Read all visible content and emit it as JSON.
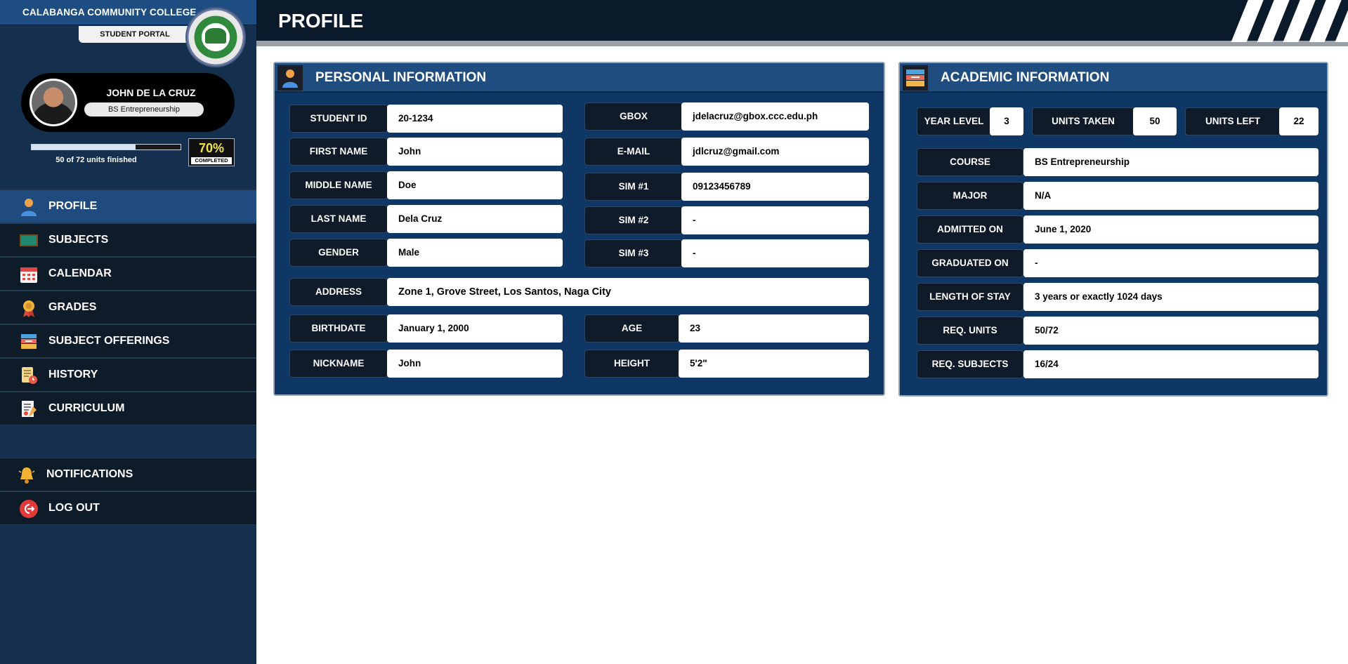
{
  "sidebar": {
    "college_name": "CALABANGA COMMUNITY COLLEGE",
    "portal_label": "STUDENT PORTAL",
    "student_name": "JOHN DE LA CRUZ",
    "course": "BS Entrepreneurship",
    "progress": {
      "fraction": 0.7,
      "text": "50 of 72 units finished",
      "percent_label": "70%",
      "completed_label": "COMPLETED"
    },
    "nav": [
      {
        "label": "PROFILE",
        "icon": "person-icon",
        "active": true
      },
      {
        "label": "SUBJECTS",
        "icon": "chalkboard-icon"
      },
      {
        "label": "CALENDAR",
        "icon": "calendar-icon"
      },
      {
        "label": "GRADES",
        "icon": "medal-icon"
      },
      {
        "label": "SUBJECT OFFERINGS",
        "icon": "books-icon"
      },
      {
        "label": "HISTORY",
        "icon": "scroll-clock-icon"
      },
      {
        "label": "CURRICULUM",
        "icon": "document-pen-icon"
      },
      {
        "label": "NOTIFICATIONS",
        "icon": "bell-icon"
      },
      {
        "label": "LOG OUT",
        "icon": "logout-icon"
      }
    ]
  },
  "header": {
    "title": "PROFILE"
  },
  "personal": {
    "title": "PERSONAL INFORMATION",
    "student_id": {
      "label": "STUDENT ID",
      "value": "20-1234"
    },
    "first_name": {
      "label": "FIRST NAME",
      "value": "John"
    },
    "middle_name": {
      "label": "MIDDLE NAME",
      "value": "Doe"
    },
    "last_name": {
      "label": "LAST NAME",
      "value": "Dela Cruz"
    },
    "gender": {
      "label": "GENDER",
      "value": "Male"
    },
    "gbox": {
      "label": "GBOX",
      "value": "jdelacruz@gbox.ccc.edu.ph"
    },
    "email": {
      "label": "E-MAIL",
      "value": "jdlcruz@gmail.com"
    },
    "sim1": {
      "label": "SIM #1",
      "value": "09123456789"
    },
    "sim2": {
      "label": "SIM #2",
      "value": "-"
    },
    "sim3": {
      "label": "SIM #3",
      "value": "-"
    },
    "address": {
      "label": "ADDRESS",
      "value": "Zone 1, Grove Street, Los Santos, Naga City"
    },
    "birthdate": {
      "label": "BIRTHDATE",
      "value": "January 1, 2000"
    },
    "nickname": {
      "label": "NICKNAME",
      "value": "John"
    },
    "age": {
      "label": "AGE",
      "value": "23"
    },
    "height": {
      "label": "HEIGHT",
      "value": "5'2\""
    }
  },
  "academic": {
    "title": "ACADEMIC INFORMATION",
    "year_level": {
      "label": "YEAR LEVEL",
      "value": "3"
    },
    "units_taken": {
      "label": "UNITS TAKEN",
      "value": "50"
    },
    "units_left": {
      "label": "UNITS LEFT",
      "value": "22"
    },
    "course": {
      "label": "COURSE",
      "value": "BS Entrepreneurship"
    },
    "major": {
      "label": "MAJOR",
      "value": "N/A"
    },
    "admitted_on": {
      "label": "ADMITTED ON",
      "value": "June 1, 2020"
    },
    "graduated_on": {
      "label": "GRADUATED ON",
      "value": "-"
    },
    "length_of_stay": {
      "label": "LENGTH OF STAY",
      "value": "3 years or exactly 1024 days"
    },
    "req_units": {
      "label": "REQ. UNITS",
      "value": "50/72"
    },
    "req_subjects": {
      "label": "REQ. SUBJECTS",
      "value": "16/24"
    }
  }
}
